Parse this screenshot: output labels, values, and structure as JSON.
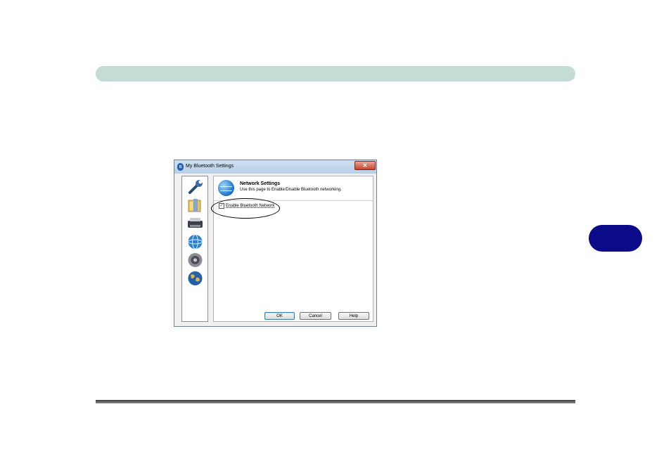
{
  "window": {
    "title": "My Bluetooth Settings",
    "close_symbol": "✕",
    "app_icon": "bluetooth-icon"
  },
  "sidebar": {
    "items": [
      {
        "icon": "wrench-icon"
      },
      {
        "icon": "folder-icon"
      },
      {
        "icon": "printer-icon"
      },
      {
        "icon": "network-globe-icon"
      },
      {
        "icon": "speaker-icon"
      },
      {
        "icon": "earth-globe-icon"
      }
    ]
  },
  "content": {
    "title": "Network Settings",
    "description": "Use this page to Enable/Disable Bluetooth networking.",
    "checkbox": {
      "label": "Enable Bluetooth Network",
      "checked": true,
      "mark": "✓"
    }
  },
  "buttons": {
    "ok": "OK",
    "cancel": "Cancel",
    "help": "Help"
  },
  "colors": {
    "header_bar": "#c3dcd6",
    "chapter_tab": "#0b0b8a"
  }
}
